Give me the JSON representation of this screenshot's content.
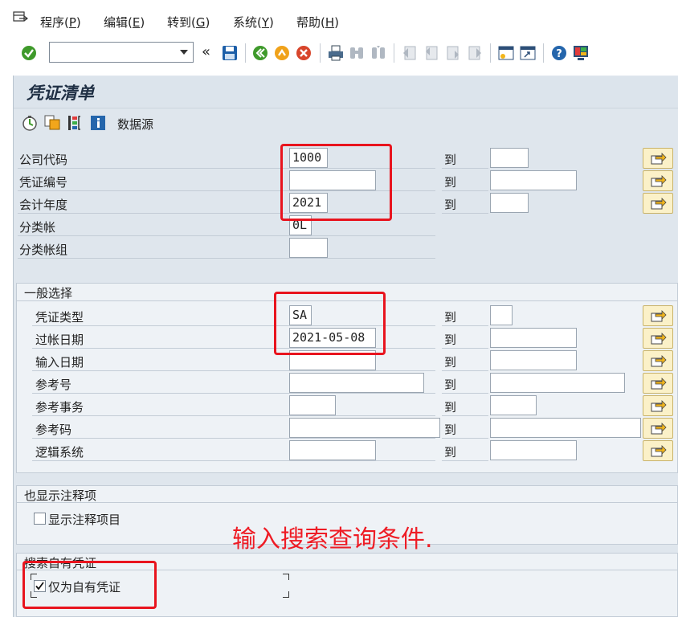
{
  "menu": {
    "items": [
      {
        "text": "程序(",
        "key": "P",
        "end": ")"
      },
      {
        "text": "编辑(",
        "key": "E",
        "end": ")"
      },
      {
        "text": "转到(",
        "key": "G",
        "end": ")"
      },
      {
        "text": "系统(",
        "key": "Y",
        "end": ")"
      },
      {
        "text": "帮助(",
        "key": "H",
        "end": ")"
      }
    ]
  },
  "toolbar": {
    "command_value": "",
    "collapse_glyph": "«"
  },
  "page": {
    "title": "凭证清单",
    "datasource_label": "数据源"
  },
  "to_label": "到",
  "main_fields": [
    {
      "label": "公司代码",
      "value": "1000",
      "to_value": ""
    },
    {
      "label": "凭证编号",
      "value": "",
      "to_value": ""
    },
    {
      "label": "会计年度",
      "value": "2021",
      "to_value": ""
    },
    {
      "label": "分类帐",
      "value": "0L"
    },
    {
      "label": "分类帐组",
      "value": ""
    }
  ],
  "general": {
    "title": "一般选择",
    "fields": [
      {
        "label": "凭证类型",
        "value": "SA",
        "to_value": ""
      },
      {
        "label": "过帐日期",
        "value": "2021-05-08",
        "to_value": ""
      },
      {
        "label": "输入日期",
        "value": "",
        "to_value": ""
      },
      {
        "label": "参考号",
        "value": "",
        "to_value": ""
      },
      {
        "label": "参考事务",
        "value": "",
        "to_value": ""
      },
      {
        "label": "参考码",
        "value": "",
        "to_value": ""
      },
      {
        "label": "逻辑系统",
        "value": "",
        "to_value": ""
      }
    ]
  },
  "notes_section": {
    "title": "也显示注释项",
    "checkbox_label": "显示注释项目",
    "checked": false
  },
  "own_docs_section": {
    "title": "搜索自有凭证",
    "checkbox_label": "仅为自有凭证",
    "checked": true
  },
  "annotation_text": "输入搜索查询条件.",
  "colors": {
    "annotation_red": "#ee1c25",
    "panel_bg": "#dfe6ed",
    "multi_btn_bg": "#fbf1c8"
  }
}
